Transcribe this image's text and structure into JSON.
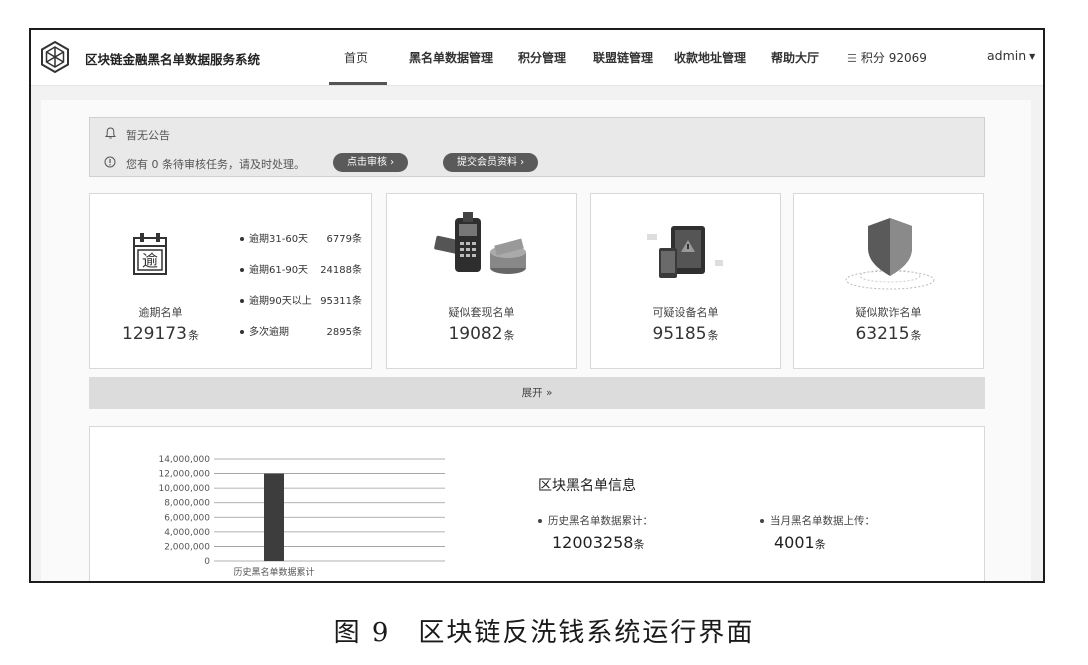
{
  "header": {
    "app_title": "区块链金融黑名单数据服务系统",
    "logo_icon": "hexagon-logo-icon",
    "nav": [
      {
        "label": "首页",
        "active": true
      },
      {
        "label": "黑名单数据管理"
      },
      {
        "label": "积分管理"
      },
      {
        "label": "联盟链管理"
      },
      {
        "label": "收款地址管理"
      },
      {
        "label": "帮助大厅"
      }
    ],
    "points_label": "积分 92069",
    "user": "admin"
  },
  "notice": {
    "announcement": "暂无公告",
    "pending_text": "您有 0 条待审核任务，请及时处理。",
    "review_button": "点击审核 ›",
    "submit_button": "提交会员资料 ›"
  },
  "cards": [
    {
      "label": "逾期名单",
      "value": "129173",
      "unit": "条",
      "icon": "calendar-overdue-icon",
      "details": [
        {
          "name": "逾期31-60天",
          "value": "6779条"
        },
        {
          "name": "逾期61-90天",
          "value": "24188条"
        },
        {
          "name": "逾期90天以上",
          "value": "95311条"
        },
        {
          "name": "多次逾期",
          "value": "2895条"
        }
      ]
    },
    {
      "label": "疑似套现名单",
      "value": "19082",
      "unit": "条",
      "icon": "pos-cash-icon"
    },
    {
      "label": "可疑设备名单",
      "value": "95185",
      "unit": "条",
      "icon": "device-warning-icon"
    },
    {
      "label": "疑似欺诈名单",
      "value": "63215",
      "unit": "条",
      "icon": "shield-icon"
    }
  ],
  "expand": {
    "label": "展开 »"
  },
  "info": {
    "title": "区块黑名单信息",
    "history_label": "历史黑名单数据累计：",
    "history_value": "12003258",
    "history_unit": "条",
    "month_label": "当月黑名单数据上传：",
    "month_value": "4001",
    "month_unit": "条"
  },
  "chart_data": {
    "type": "bar",
    "categories": [
      "历史黑名单数据累计"
    ],
    "values": [
      12003258
    ],
    "ylim": [
      0,
      14000000
    ],
    "ticks": [
      "14,000,000",
      "12,000,000",
      "10,000,000",
      "8,000,000",
      "6,000,000",
      "4,000,000",
      "2,000,000",
      "0"
    ],
    "bar_color": "#3d3d3d",
    "grid": true
  },
  "caption": "图 9　区块链反洗钱系统运行界面"
}
